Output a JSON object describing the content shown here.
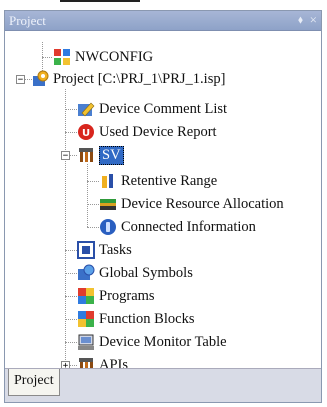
{
  "panel": {
    "title": "Project",
    "pin_glyph": "✕",
    "close_glyph": "×"
  },
  "tree": {
    "nwconfig": "NWCONFIG",
    "project": "Project [C:\\PRJ_1\\PRJ_1.isp]",
    "device_comment": "Device Comment List",
    "used_device": "Used Device Report",
    "sv": "SV",
    "retentive": "Retentive Range",
    "device_resource": "Device Resource Allocation",
    "connected": "Connected Information",
    "tasks": "Tasks",
    "global_symbols": "Global Symbols",
    "programs": "Programs",
    "function_blocks": "Function Blocks",
    "device_monitor": "Device Monitor Table",
    "apis": "APIs",
    "expanded_glyph": "−",
    "collapsed_glyph": "+"
  },
  "tabs": {
    "project": "Project"
  },
  "colors": {
    "title_bar": "#9aaccf",
    "selection": "#316ac5",
    "tab_strip": "#d8dbe6"
  }
}
